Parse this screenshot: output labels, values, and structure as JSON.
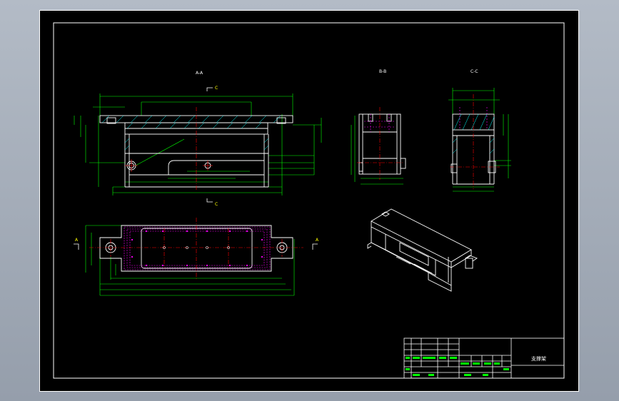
{
  "drawing": {
    "title_block_name": "支撑架",
    "section_labels": {
      "a": "A-A",
      "b": "B-B",
      "c": "C-C"
    },
    "cut_marks": {
      "top_left": "C",
      "bottom_left": "C",
      "side_left": "A",
      "side_right": "A"
    }
  },
  "colors": {
    "sheet_background": "#000000",
    "geometry": "#ffffff",
    "dimension": "#00ff00",
    "hatch": "#00ffff",
    "centerline": "#ff0000",
    "hidden": "#ff00ff",
    "text": "#ffffff",
    "app_background": "#a3acb8"
  }
}
